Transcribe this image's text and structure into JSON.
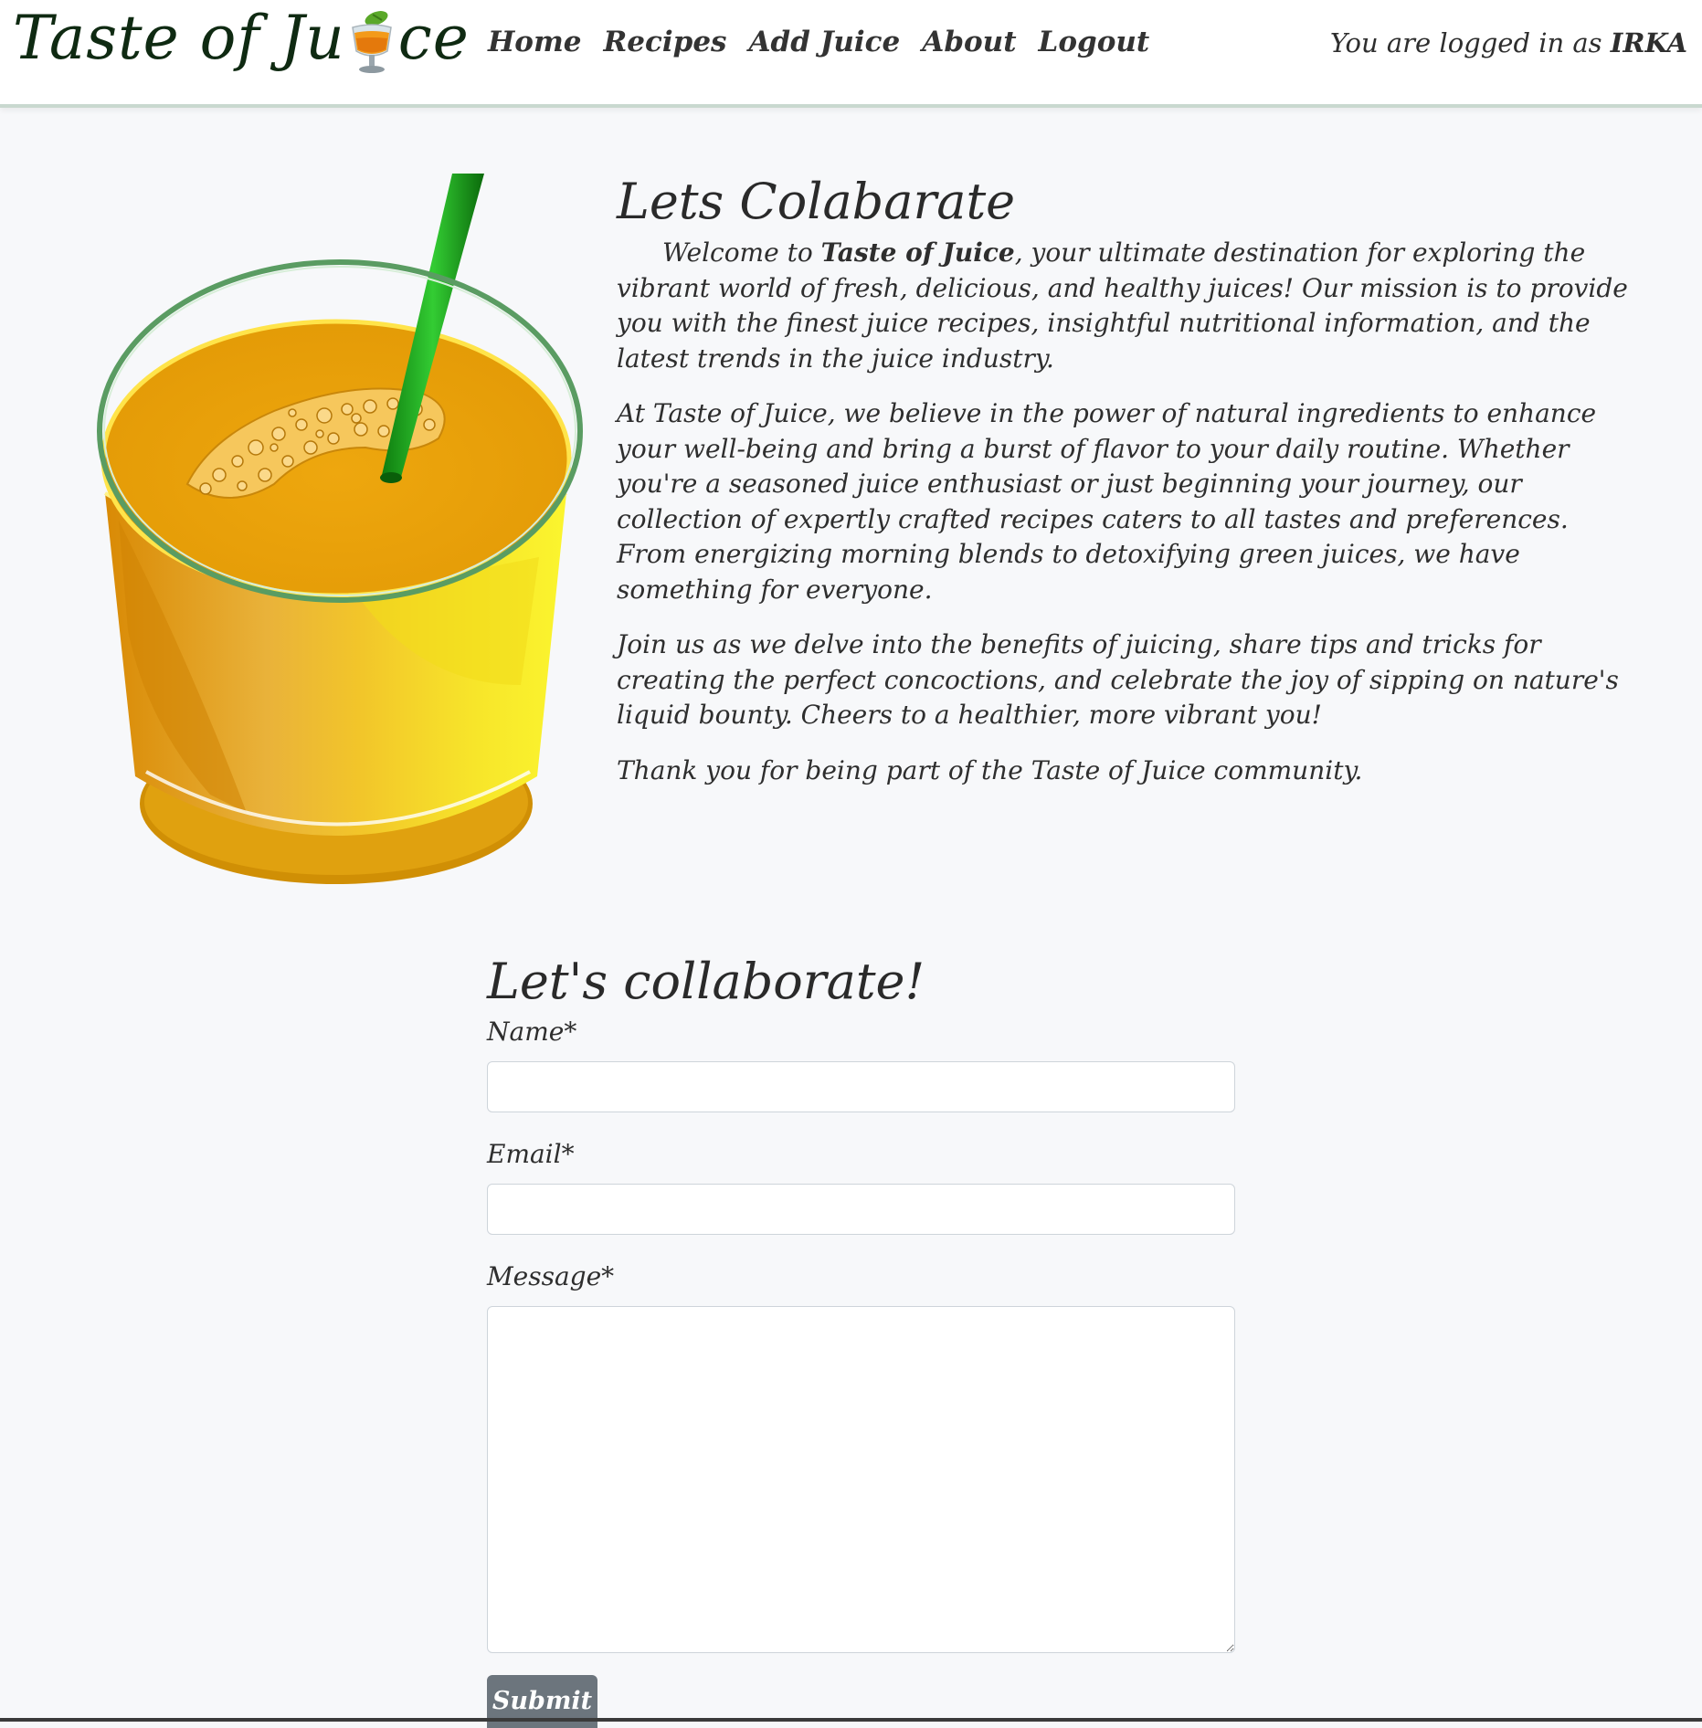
{
  "navbar": {
    "brand_prefix": "Taste of Ju",
    "brand_suffix": "ce",
    "brand_icon": "tropical-drink-icon",
    "links": [
      {
        "label": "Home"
      },
      {
        "label": "Recipes"
      },
      {
        "label": "Add Juice"
      },
      {
        "label": "About"
      },
      {
        "label": "Logout"
      }
    ],
    "login_prefix": "You are logged in as ",
    "login_user": "IRKA"
  },
  "about": {
    "title": "Lets Colabarate",
    "p1_before": "Welcome to ",
    "p1_bold": "Taste of Juice",
    "p1_after": ", your ultimate destination for exploring the vibrant world of fresh, delicious, and healthy juices! Our mission is to provide you with the finest juice recipes, insightful nutritional information, and the latest trends in the juice industry.",
    "p2": "At Taste of Juice, we believe in the power of natural ingredients to enhance your well-being and bring a burst of flavor to your daily routine. Whether you're a seasoned juice enthusiast or just beginning your journey, our collection of expertly crafted recipes caters to all tastes and preferences. From energizing morning blends to detoxifying green juices, we have something for everyone.",
    "p3": "Join us as we delve into the benefits of juicing, share tips and tricks for creating the perfect concoctions, and celebrate the joy of sipping on nature's liquid bounty. Cheers to a healthier, more vibrant you!",
    "p4": "Thank you for being part of the Taste of Juice community.",
    "image_icon": "orange-juice-glass-icon"
  },
  "form": {
    "title": "Let's collaborate!",
    "name_label": "Name*",
    "email_label": "Email*",
    "message_label": "Message*",
    "name_value": "",
    "email_value": "",
    "message_value": "",
    "submit_label": "Submit"
  },
  "colors": {
    "page_bg": "#f7f8fa",
    "navbar_bg": "#ffffff",
    "brand": "#0f2a12",
    "submit_bg": "#6c757d",
    "juice": "#f0a90b",
    "straw": "#1fa31f"
  }
}
